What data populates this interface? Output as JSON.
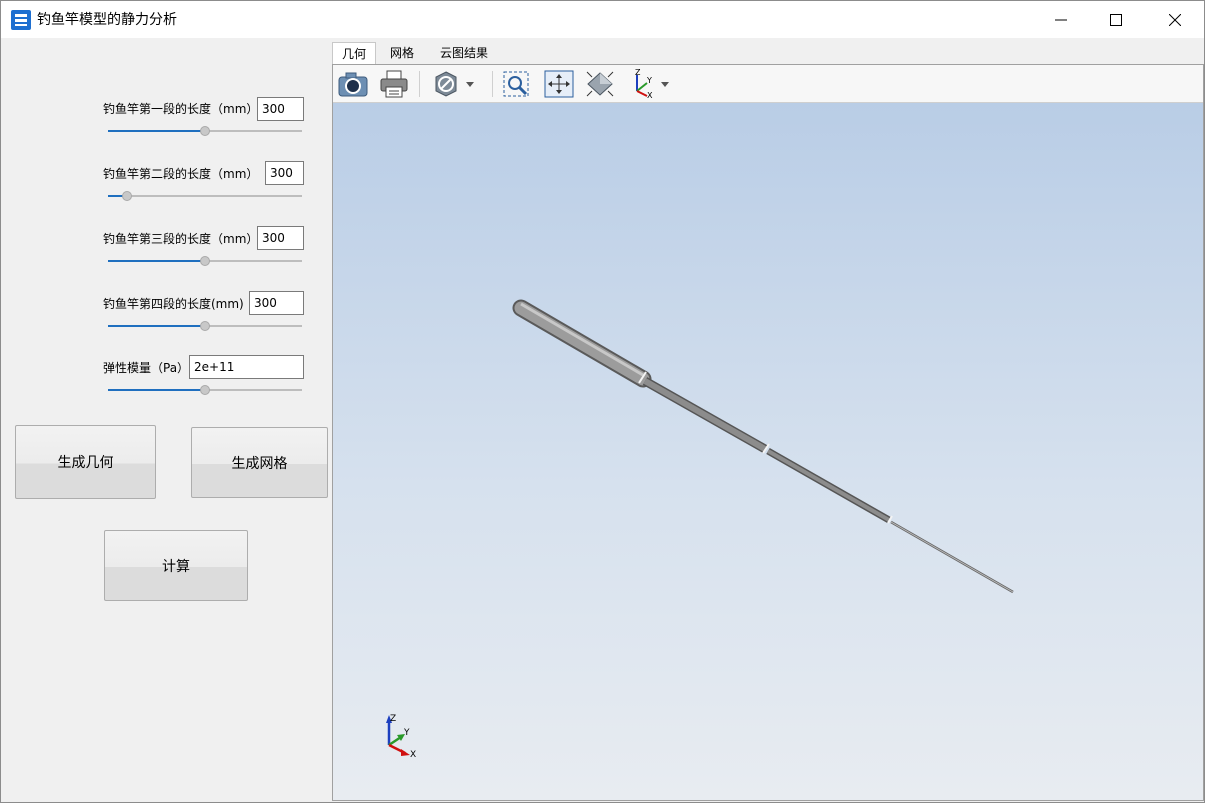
{
  "window": {
    "title": "钓鱼竿模型的静力分析"
  },
  "params": [
    {
      "label": "钓鱼竿第一段的长度（mm）",
      "value": "300",
      "slider_fraction": 0.5
    },
    {
      "label": "钓鱼竿第二段的长度（mm）",
      "value": "300",
      "slider_fraction": 0.1
    },
    {
      "label": "钓鱼竿第三段的长度（mm）",
      "value": "300",
      "slider_fraction": 0.5
    },
    {
      "label": "钓鱼竿第四段的长度(mm)",
      "value": "300",
      "slider_fraction": 0.5
    },
    {
      "label": "弹性模量（Pa）",
      "value": "2e+11",
      "slider_fraction": 0.5
    }
  ],
  "buttons": {
    "generate_geometry": "生成几何",
    "generate_mesh": "生成网格",
    "compute": "计算"
  },
  "tabs": [
    {
      "label": "几何",
      "active": true
    },
    {
      "label": "网格",
      "active": false
    },
    {
      "label": "云图结果",
      "active": false
    }
  ],
  "toolbar": {
    "icons": [
      "camera-icon",
      "print-icon",
      "display-mode-icon",
      "zoom-box-icon",
      "fit-all-icon",
      "isometric-view-icon",
      "axis-view-icon"
    ]
  },
  "axis_triad": {
    "x": "X",
    "y": "Y",
    "z": "Z"
  },
  "colors": {
    "accent": "#1f6fbf",
    "viewport_top": "#b9cde6",
    "viewport_bottom": "#e8ecf1",
    "rod": "#8a8a8a"
  }
}
